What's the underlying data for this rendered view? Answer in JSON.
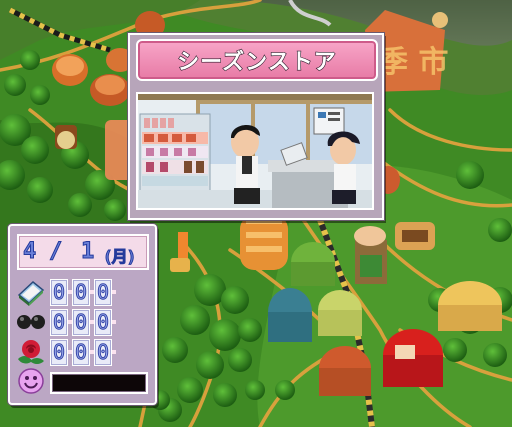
{
  "store": {
    "title": "シーズンストア"
  },
  "status": {
    "month": "4",
    "separator": "/",
    "day": "1",
    "weekday": "(月)",
    "rows": [
      {
        "icon": "book-icon",
        "digits": [
          "0",
          "0",
          "0"
        ]
      },
      {
        "icon": "dumbbell-icon",
        "digits": [
          "0",
          "0",
          "0"
        ]
      },
      {
        "icon": "rose-icon",
        "digits": [
          "0",
          "0",
          "0"
        ]
      }
    ],
    "mood_icon": "smiley-face-icon"
  },
  "colors": {
    "title_plate": "#e77aa5",
    "panel": "#bba7c4",
    "digit_text": "#3545a8"
  }
}
